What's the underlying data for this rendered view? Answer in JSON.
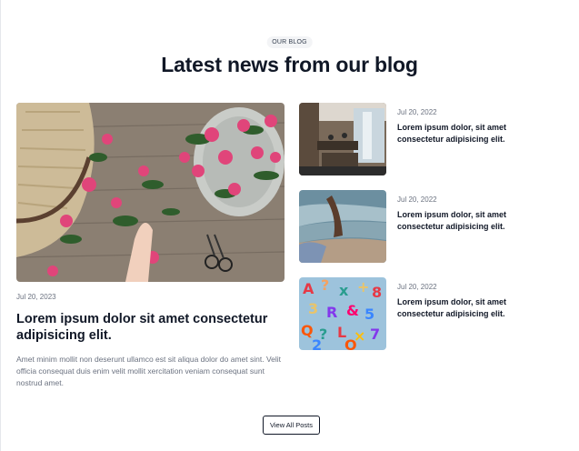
{
  "section": {
    "eyebrow": "OUR BLOG",
    "title": "Latest news from our blog"
  },
  "featured": {
    "image_alt": "pink-roses-flatlay-photo",
    "date": "Jul 20, 2023",
    "title": "Lorem ipsum dolor sit amet consectetur adipisicing elit.",
    "excerpt": "Amet minim mollit non deserunt ullamco est sit aliqua dolor do amet sint. Velit officia consequat duis enim velit mollit xercitation veniam consequat sunt nostrud amet."
  },
  "side_posts": [
    {
      "image": "office-interior-photo",
      "date": "Jul 20, 2022",
      "title": "Lorem ipsum dolor, sit amet consectetur adipisicing elit."
    },
    {
      "image": "beach-hand-photo",
      "date": "Jul 20, 2022",
      "title": "Lorem ipsum dolor, sit amet consectetur adipisicing elit."
    },
    {
      "image": "colorful-letters-photo",
      "date": "Jul 20, 2022",
      "title": "Lorem ipsum dolor, sit amet consectetur adipisicing elit."
    }
  ],
  "actions": {
    "view_all_label": "View All Posts"
  }
}
